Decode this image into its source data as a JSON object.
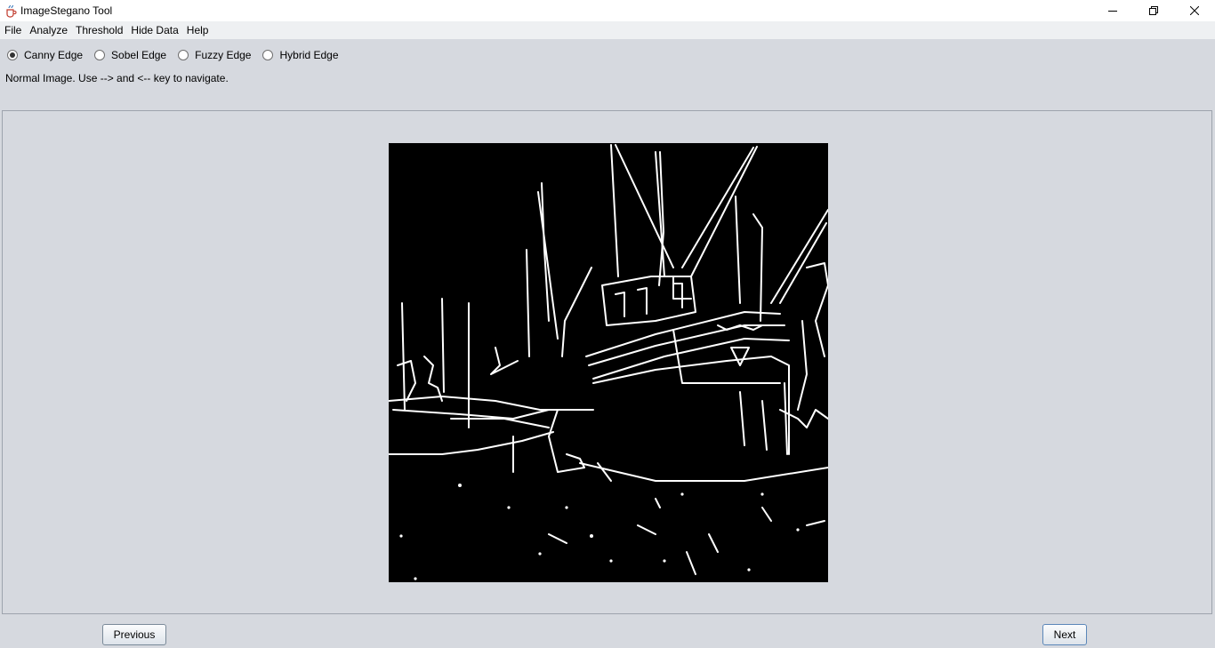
{
  "window": {
    "title": "ImageStegano Tool",
    "icons": [
      "java-cup-icon",
      "minimize-icon",
      "maximize-icon",
      "close-icon"
    ]
  },
  "menu": {
    "items": [
      "File",
      "Analyze",
      "Threshold",
      "Hide Data",
      "Help"
    ]
  },
  "edge_options": {
    "items": [
      "Canny Edge",
      "Sobel Edge",
      "Fuzzy Edge",
      "Hybrid Edge"
    ],
    "selected": "Canny Edge"
  },
  "status": {
    "text": "Normal Image. Use --> and <-- key to navigate."
  },
  "nav": {
    "previous_label": "Previous",
    "next_label": "Next"
  },
  "colors": {
    "background": "#d6d9df",
    "image_background": "#000000",
    "edges": "#ffffff"
  }
}
